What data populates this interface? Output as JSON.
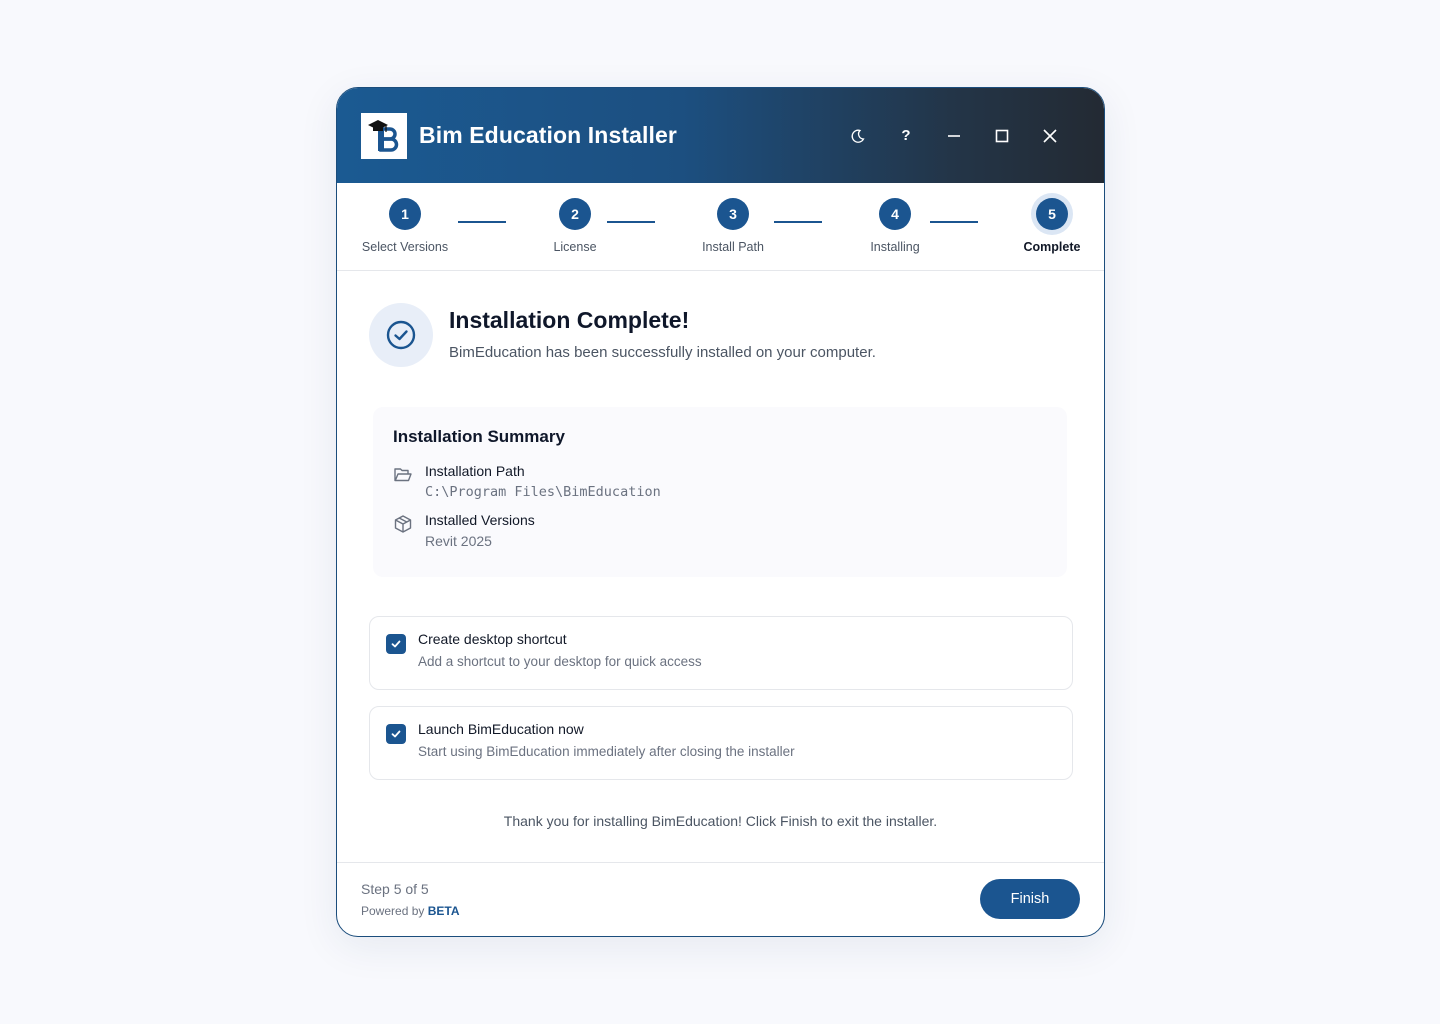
{
  "window": {
    "title": "Bim Education Installer",
    "logo_icon": "graduation-cap-b-logo",
    "controls": [
      "moon-icon",
      "help-icon",
      "minimize-icon",
      "maximize-icon",
      "close-icon"
    ],
    "help_label": "?"
  },
  "steps": [
    {
      "number": "1",
      "label": "Select Versions"
    },
    {
      "number": "2",
      "label": "License"
    },
    {
      "number": "3",
      "label": "Install Path"
    },
    {
      "number": "4",
      "label": "Installing"
    },
    {
      "number": "5",
      "label": "Complete"
    }
  ],
  "active_step": 5,
  "success": {
    "title": "Installation Complete!",
    "subtitle": "BimEducation has been successfully installed on your computer."
  },
  "summary": {
    "title": "Installation Summary",
    "items": [
      {
        "icon": "folder-icon",
        "label": "Installation Path",
        "value": "C:\\Program Files\\BimEducation"
      },
      {
        "icon": "package-icon",
        "label": "Installed Versions",
        "value": "Revit 2025"
      }
    ]
  },
  "options": [
    {
      "title": "Create desktop shortcut",
      "description": "Add a shortcut to your desktop for quick access",
      "checked": true
    },
    {
      "title": "Launch BimEducation now",
      "description": "Start using BimEducation immediately after closing the installer",
      "checked": true
    }
  ],
  "thanks_message": "Thank you for installing BimEducation! Click Finish to exit the installer.",
  "footer": {
    "step_count": "Step 5 of 5",
    "powered_prefix": "Powered by",
    "powered_brand": "BETA",
    "finish_label": "Finish"
  },
  "colors": {
    "accent": "#1b5590",
    "border": "#1b4d7c",
    "header_start": "#1b5a92",
    "header_end": "#232a33"
  }
}
